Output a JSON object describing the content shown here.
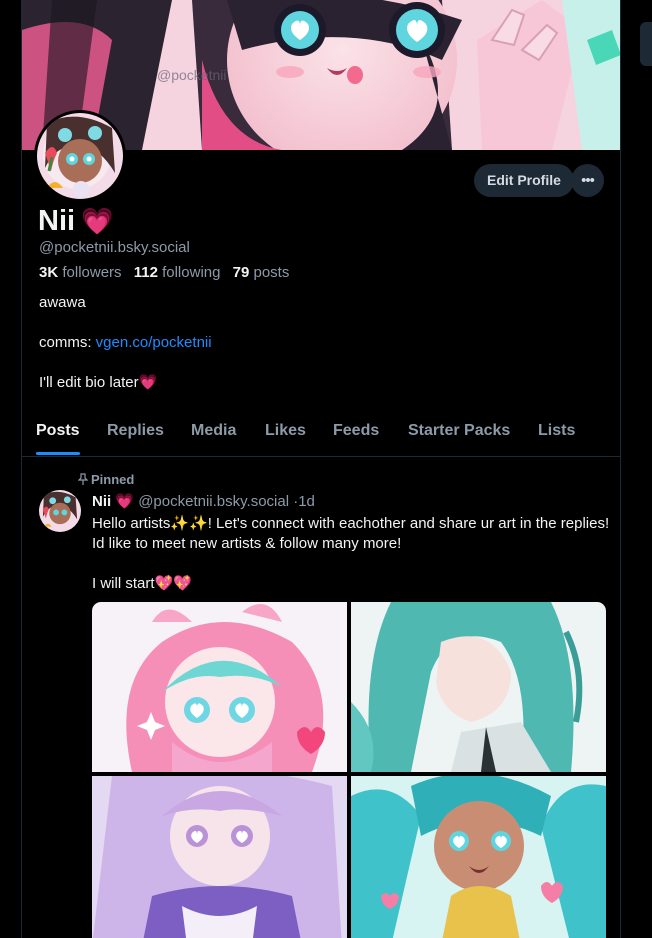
{
  "profile": {
    "display_name": "Nii",
    "name_emoji": "💗",
    "handle": "@pocketnii.bsky.social",
    "followers_count": "3K",
    "followers_label": "followers",
    "following_count": "112",
    "following_label": "following",
    "posts_count": "79",
    "posts_label": "posts",
    "bio_line1": "awawa",
    "bio_comms_label": "comms: ",
    "bio_comms_link": "vgen.co/pocketnii",
    "bio_line3": "I'll edit bio later💗",
    "banner_watermark": "@pocketnii"
  },
  "actions": {
    "edit_profile_label": "Edit Profile",
    "more_label": "•••"
  },
  "tabs": [
    "Posts",
    "Replies",
    "Media",
    "Likes",
    "Feeds",
    "Starter Packs",
    "Lists"
  ],
  "active_tab": "Posts",
  "post": {
    "pinned_label": "Pinned",
    "author_name": "Nii",
    "author_emoji": "💗",
    "author_handle": "@pocketnii.bsky.social",
    "separator": "·",
    "time": "1d",
    "text_para1": "Hello artists✨✨! Let's connect with eachother and share ur art in the replies! Id like to meet new artists & follow many more!",
    "text_para2": "I will start💖💖",
    "images": [
      {
        "icon": "pink-bunny-hood-girl-artwork"
      },
      {
        "icon": "teal-hair-portrait-artwork"
      },
      {
        "icon": "lavender-hair-girl-artwork"
      },
      {
        "icon": "teal-twintails-girl-artwork"
      }
    ]
  },
  "colors": {
    "background": "#000000",
    "border": "#1e2936",
    "text_primary": "#f1f3f5",
    "text_secondary": "#8d9aa8",
    "link": "#208bfe",
    "button_bg": "#1e2936"
  }
}
